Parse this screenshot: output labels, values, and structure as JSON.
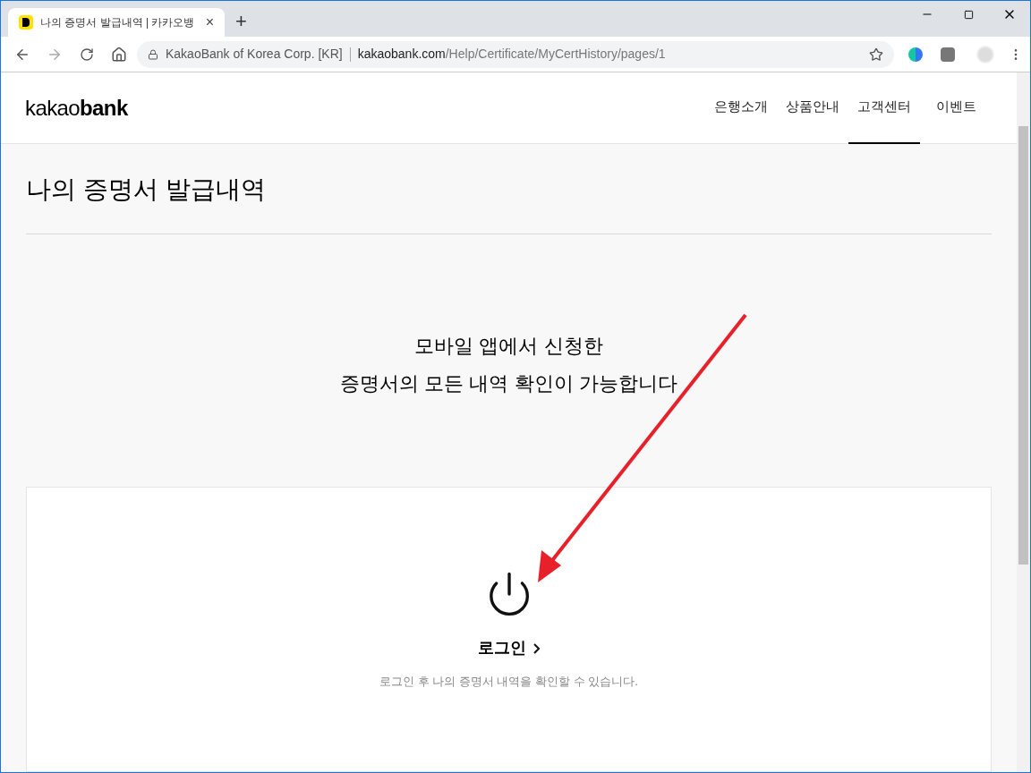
{
  "browser": {
    "tab_title": "나의 증명서 발급내역 | 카카오뱅",
    "tab_close": "×",
    "new_tab": "+",
    "site_identity": "KakaoBank of Korea Corp. [KR]",
    "url_domain": "kakaobank.com",
    "url_path": "/Help/Certificate/MyCertHistory/pages/1"
  },
  "header": {
    "logo_light": "kakao",
    "logo_bold": "bank",
    "nav": [
      {
        "label": "은행소개",
        "selected": false
      },
      {
        "label": "상품안내",
        "selected": false
      },
      {
        "label": "고객센터",
        "selected": true
      },
      {
        "label": "이벤트",
        "selected": false
      }
    ]
  },
  "page_title": "나의 증명서 발급내역",
  "message_lines": [
    "모바일 앱에서 신청한",
    "증명서의 모든 내역 확인이 가능합니다"
  ],
  "login": {
    "label": "로그인",
    "note": "로그인 후 나의 증명서 내역을 확인할 수 있습니다."
  }
}
